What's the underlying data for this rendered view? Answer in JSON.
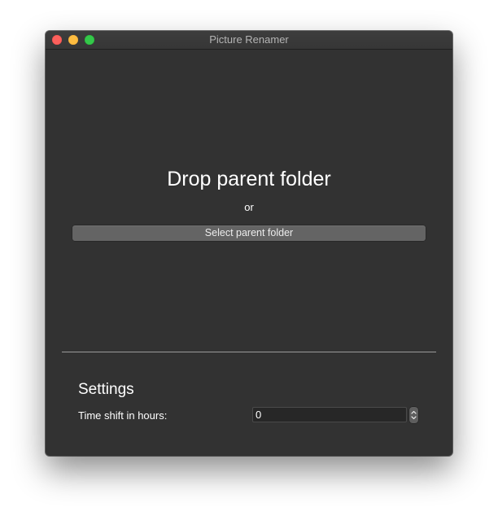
{
  "window": {
    "title": "Picture Renamer"
  },
  "drop_area": {
    "heading": "Drop parent folder",
    "or_label": "or",
    "select_button_label": "Select parent folder"
  },
  "settings": {
    "heading": "Settings",
    "time_shift_label": "Time shift in hours:",
    "time_shift_value": "0"
  },
  "icons": {
    "close": "close-icon",
    "minimize": "minimize-icon",
    "zoom": "zoom-icon",
    "stepper": "chevron-up-down-icon"
  },
  "colors": {
    "window_background": "#323232",
    "close": "#fc605c",
    "minimize": "#fdbc40",
    "zoom": "#34c84a",
    "button": "#646464"
  }
}
